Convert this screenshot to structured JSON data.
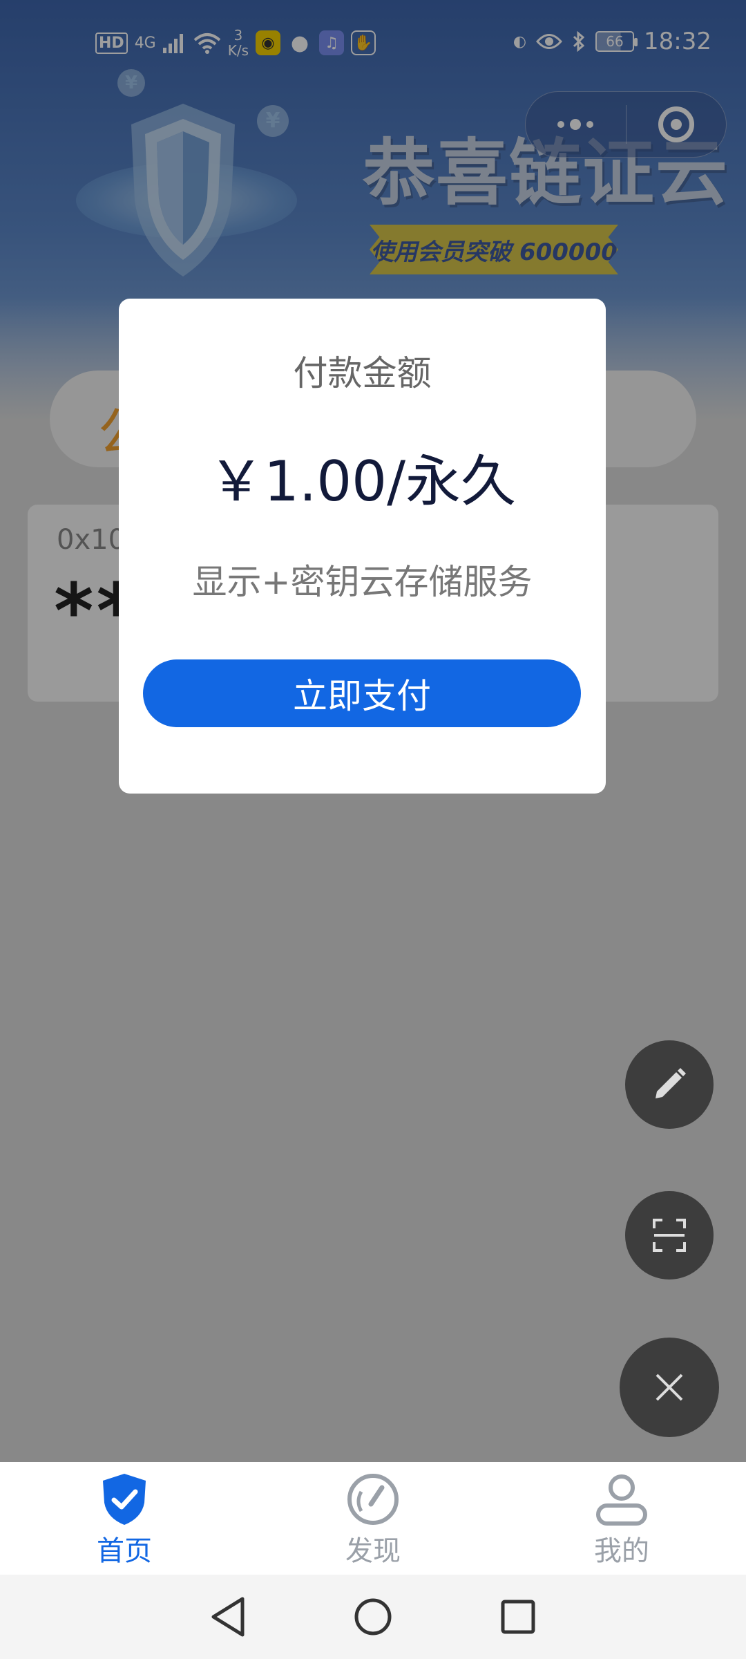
{
  "status_bar": {
    "hd": "HD",
    "network": "4G",
    "speed_value": "3",
    "speed_unit": "K/s",
    "battery": "66",
    "time": "18:32"
  },
  "banner": {
    "title": "恭喜链证云",
    "ribbon": "使用会员突破 600000",
    "yen_symbol": "¥"
  },
  "background_page": {
    "pill_char": "公",
    "card_address": "0x10",
    "card_masked": "**"
  },
  "payment_dialog": {
    "title": "付款金额",
    "price": "￥1.00/永久",
    "description": "显示+密钥云存储服务",
    "pay_button": "立即支付"
  },
  "tabs": [
    {
      "label": "首页",
      "icon": "shield-check-icon",
      "active": true
    },
    {
      "label": "发现",
      "icon": "gauge-icon",
      "active": false
    },
    {
      "label": "我的",
      "icon": "user-icon",
      "active": false
    }
  ],
  "floating_buttons": [
    "edit-icon",
    "scan-icon",
    "close-icon"
  ],
  "colors": {
    "primary": "#1267e3",
    "price": "#121a3a",
    "fab": "#3d3d3d",
    "banner": "#3e66ad"
  }
}
